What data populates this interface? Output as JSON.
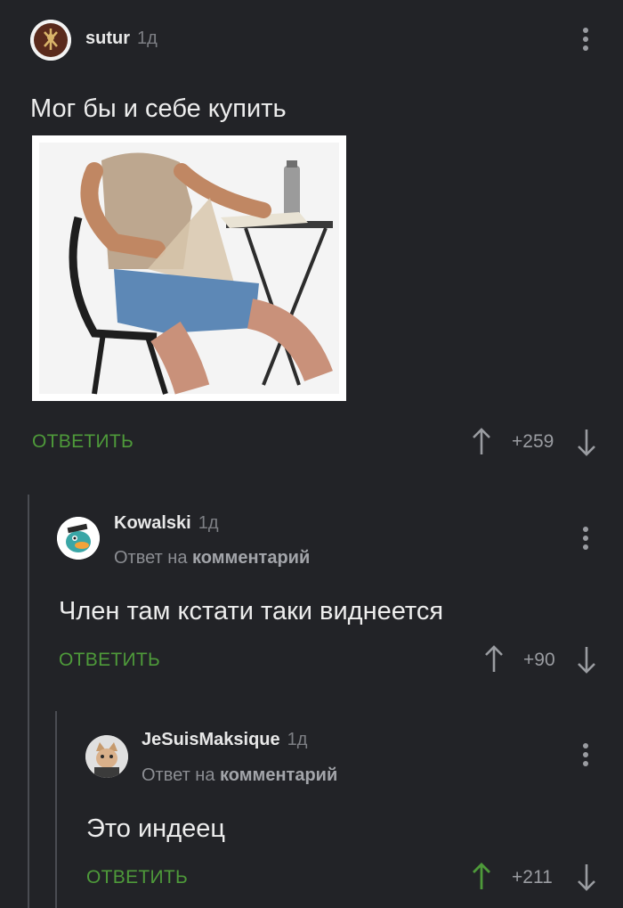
{
  "comments": [
    {
      "username": "sutur",
      "time": "1д",
      "text": "Мог бы и себе купить",
      "reply_label": "ОТВЕТИТЬ",
      "score": "+259"
    },
    {
      "username": "Kowalski",
      "time": "1д",
      "reply_prefix": "Ответ на",
      "reply_target": "комментарий",
      "text": "Член там кстати таки виднеется",
      "reply_label": "ОТВЕТИТЬ",
      "score": "+90"
    },
    {
      "username": "JeSuisMaksique",
      "time": "1д",
      "reply_prefix": "Ответ на",
      "reply_target": "комментарий",
      "text": "Это индеец",
      "reply_label": "ОТВЕТИТЬ",
      "score": "+211",
      "upvoted": true
    }
  ],
  "colors": {
    "background": "#222327",
    "accent_green": "#4e9a3a",
    "muted": "#9a9ca1"
  },
  "icons": [
    "kebab-menu-icon",
    "upvote-arrow-icon",
    "downvote-arrow-icon"
  ]
}
